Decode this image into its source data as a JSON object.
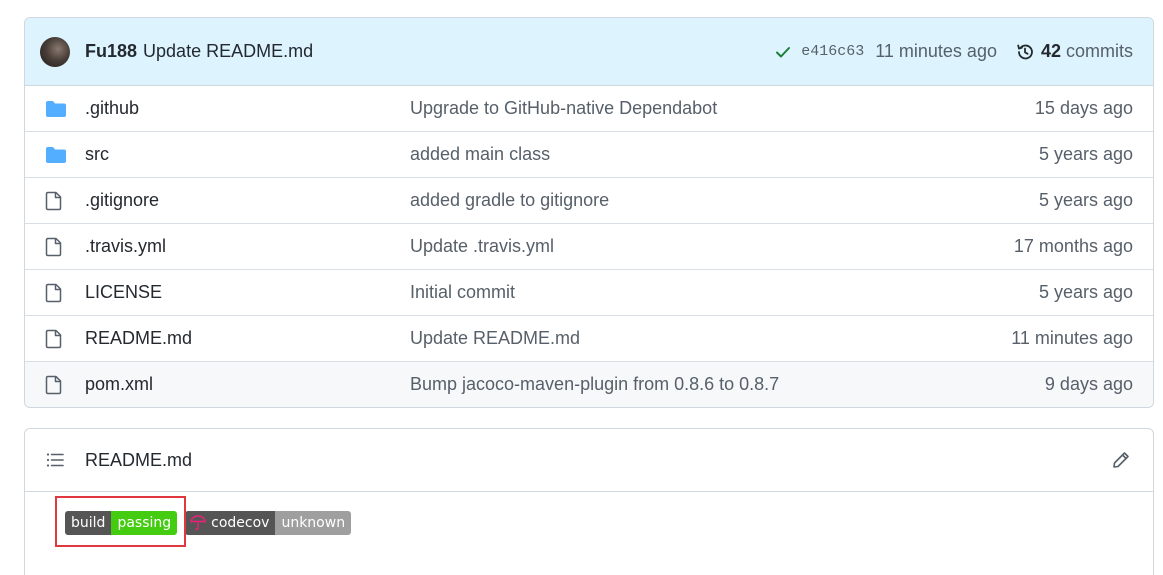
{
  "latest_commit": {
    "author": "Fu188",
    "message": "Update README.md",
    "sha": "e416c63",
    "time_ago": "11 minutes ago",
    "commit_count": "42",
    "commits_label": "commits"
  },
  "files": [
    {
      "name": ".github",
      "type": "folder",
      "message": "Upgrade to GitHub-native Dependabot",
      "age": "15 days ago"
    },
    {
      "name": "src",
      "type": "folder",
      "message": "added main class",
      "age": "5 years ago"
    },
    {
      "name": ".gitignore",
      "type": "file",
      "message": "added gradle to gitignore",
      "age": "5 years ago"
    },
    {
      "name": ".travis.yml",
      "type": "file",
      "message": "Update .travis.yml",
      "age": "17 months ago"
    },
    {
      "name": "LICENSE",
      "type": "file",
      "message": "Initial commit",
      "age": "5 years ago"
    },
    {
      "name": "README.md",
      "type": "file",
      "message": "Update README.md",
      "age": "11 minutes ago"
    },
    {
      "name": "pom.xml",
      "type": "file",
      "message": "Bump jacoco-maven-plugin from 0.8.6 to 0.8.7",
      "age": "9 days ago"
    }
  ],
  "readme": {
    "title": "README.md",
    "badges": {
      "build": {
        "label": "build",
        "value": "passing"
      },
      "codecov": {
        "label": "codecov",
        "value": "unknown"
      }
    }
  },
  "colors": {
    "folder": "#54aeff",
    "file": "#57606a",
    "check": "#1a7f37",
    "badge_pass": "#44cc11",
    "badge_unknown": "#9f9f9f",
    "highlight": "#e0383e"
  }
}
